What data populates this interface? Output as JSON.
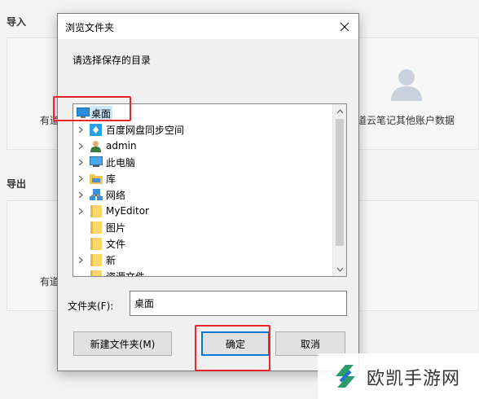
{
  "background": {
    "import_title": "导入",
    "export_title": "导出",
    "card1_text": "有道",
    "card2_text": "道云笔记其他账户数据",
    "card3_text": "有道"
  },
  "dialog": {
    "title": "浏览文件夹",
    "prompt": "请选择保存的目录",
    "tree": [
      {
        "label": "桌面",
        "icon": "desktop-icon",
        "selected": true
      },
      {
        "label": "百度网盘同步空间",
        "icon": "cloud-sync-icon"
      },
      {
        "label": "admin",
        "icon": "user-icon"
      },
      {
        "label": "此电脑",
        "icon": "computer-icon"
      },
      {
        "label": "库",
        "icon": "library-icon"
      },
      {
        "label": "网络",
        "icon": "network-icon"
      },
      {
        "label": "MyEditor",
        "icon": "folder-icon"
      },
      {
        "label": "图片",
        "icon": "folder-icon"
      },
      {
        "label": "文件",
        "icon": "folder-icon"
      },
      {
        "label": "新",
        "icon": "folder-icon"
      },
      {
        "label": "资源文件",
        "icon": "folder-icon"
      }
    ],
    "folder_label": "文件夹(F):",
    "folder_value": "桌面",
    "new_folder_button": "新建文件夹(M)",
    "ok_button": "确定",
    "cancel_button": "取消"
  },
  "watermark": {
    "text": "欧凯手游网"
  },
  "colors": {
    "highlight": "#e8262b",
    "selection": "#cce8ff",
    "accent": "#0078d7"
  }
}
